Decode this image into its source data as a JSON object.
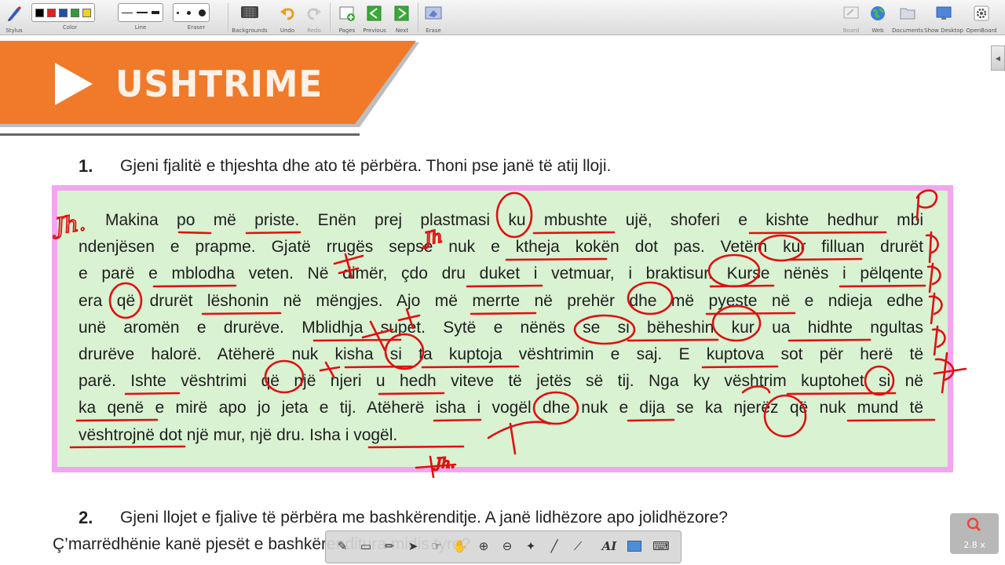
{
  "toolbar": {
    "stylus": "Stylus",
    "color": "Color",
    "line": "Line",
    "eraser": "Eraser",
    "backgrounds": "Backgrounds",
    "undo": "Undo",
    "redo": "Redo",
    "pages": "Pages",
    "previous": "Previous",
    "next": "Next",
    "erase": "Erase",
    "board": "Board",
    "web": "Web",
    "documents": "Documents",
    "show_desktop": "Show Desktop",
    "openboard": "OpenBoard",
    "colors": [
      "#000000",
      "#e02020",
      "#1f4fa8",
      "#2e9e3a",
      "#f2d21b"
    ]
  },
  "page": {
    "banner_title": "USHTRIME",
    "banner_color": "#f07a2a",
    "q1_number": "1.",
    "q1_text": "Gjeni fjalitë e thjeshta dhe ato të përbëra. Thoni pse janë të atij lloji.",
    "passage": [
      "Makina po më priste. Enën prej plastmasi ku mbushte ujë, shoferi e kishte hedhur mbi",
      "ndenjësen e prapme. Gjatë rrugës sepse nuk e ktheja kokën dot pas. Vetëm kur filluan drurët",
      "e parë e mblodha veten. Në dimër, çdo dru duket i vetmuar, i braktisur. Kurse nënës i pëlqente",
      "era që drurët lëshonin në mëngjes. Ajo më merrte në prehër dhe më pyeste në e ndieja edhe",
      "unë aromën e drurëve. Mblidhja supet. Sytë e nënës se si bëheshin kur ua hidhte ngultas",
      "drurëve halorë. Atëherë nuk kisha si ta kuptoja vështrimin e saj. E kuptova sot për herë të",
      "parë. Ishte vështrimi që një njeri u hedh viteve të jetës së tij. Nga ky vështrim kuptohet si në",
      "ka qenë e mirë apo jo jeta e tij. Atëherë isha i vogël dhe nuk e dija se ka njerëz që nuk mund të",
      "vështrojnë dot një mur, një dru. Isha i vogël."
    ],
    "q2_number": "2.",
    "q2_line1": "Gjeni llojet e fjalive të përbëra me bashkërenditje. A janë lidhëzore apo jolidhëzore?",
    "q2_line2": "Ç’marrëdhënie kanë pjesët e bashkërenditura midis tyre?"
  },
  "annotations": {
    "ink_color": "#e01010",
    "labels": [
      "Jh.",
      "Jh",
      "Jh."
    ]
  },
  "floatbar": {
    "text_tool": "AI"
  },
  "zoom": {
    "level": "2.8 x"
  }
}
